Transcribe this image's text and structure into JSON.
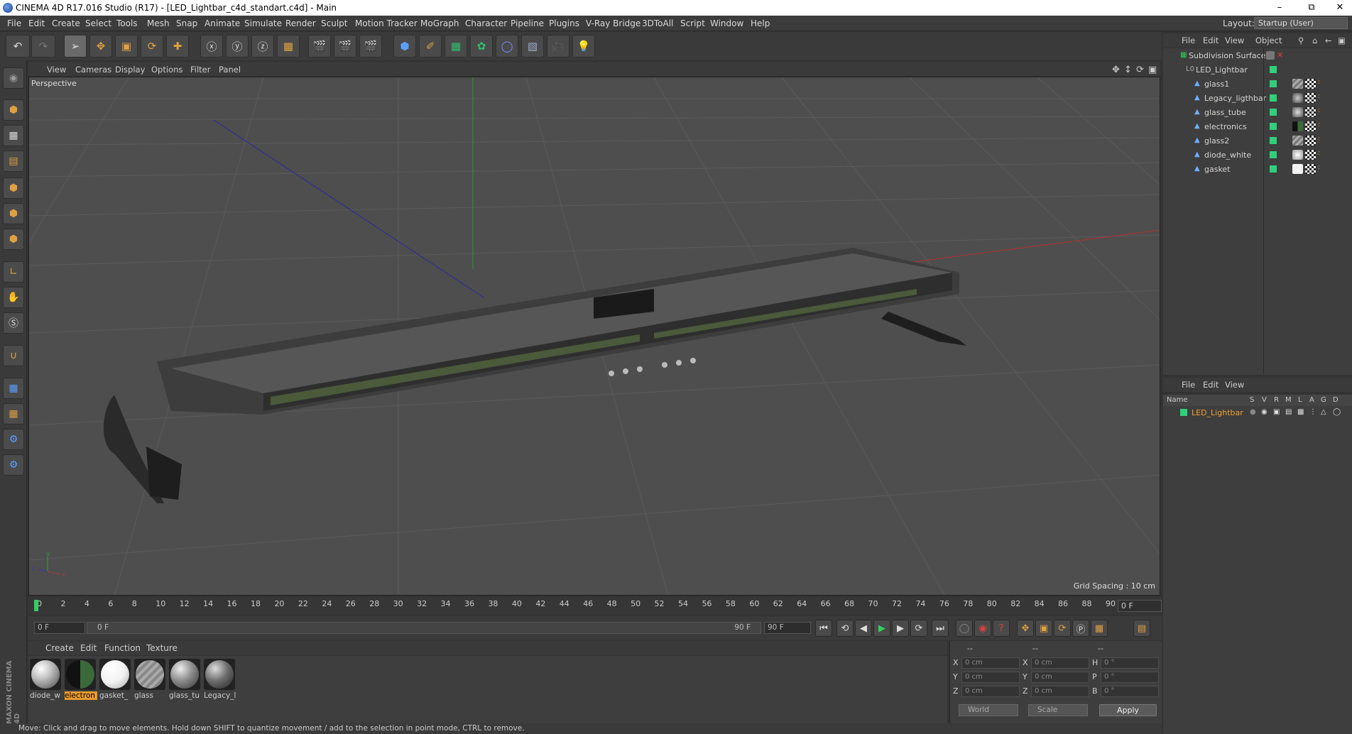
{
  "window": {
    "title": "CINEMA 4D R17.016 Studio (R17) - [LED_Lightbar_c4d_standart.c4d] - Main"
  },
  "menubar": {
    "items": [
      "File",
      "Edit",
      "Create",
      "Select",
      "Tools",
      "Mesh",
      "Snap",
      "Animate",
      "Simulate",
      "Render",
      "Sculpt",
      "Motion Tracker",
      "MoGraph",
      "Character",
      "Pipeline",
      "Plugins",
      "V-Ray Bridge",
      "3DToAll",
      "Script",
      "Window",
      "Help"
    ],
    "layout_label": "Layout:",
    "layout_value": "Startup (User)"
  },
  "viewport": {
    "menu": [
      "View",
      "Cameras",
      "Display",
      "Options",
      "Filter",
      "Panel"
    ],
    "label": "Perspective",
    "grid_spacing": "Grid Spacing : 10 cm"
  },
  "timeline": {
    "ticks": [
      "0",
      "2",
      "4",
      "6",
      "8",
      "10",
      "12",
      "14",
      "16",
      "18",
      "20",
      "22",
      "24",
      "26",
      "28",
      "30",
      "32",
      "34",
      "36",
      "38",
      "40",
      "42",
      "44",
      "46",
      "48",
      "50",
      "52",
      "54",
      "56",
      "58",
      "60",
      "62",
      "64",
      "66",
      "68",
      "70",
      "72",
      "74",
      "76",
      "78",
      "80",
      "82",
      "84",
      "86",
      "88",
      "90"
    ],
    "current_frame": "0 F",
    "start_field": "0 F",
    "range_start": "0 F",
    "range_end": "90 F",
    "end_field": "90 F"
  },
  "materials": {
    "menu": [
      "Create",
      "Edit",
      "Function",
      "Texture"
    ],
    "items": [
      {
        "name": "diode_w",
        "color": "#bdbdbd",
        "selected": false
      },
      {
        "name": "electron",
        "color": "#2b2b2b",
        "selected": true
      },
      {
        "name": "gasket_",
        "color": "#f2f2f2",
        "selected": false
      },
      {
        "name": "glass",
        "color": "#9a9a9a",
        "selected": false
      },
      {
        "name": "glass_tu",
        "color": "#8c8c8c",
        "selected": false
      },
      {
        "name": "Legacy_l",
        "color": "#6f6f6f",
        "selected": false
      }
    ]
  },
  "coords": {
    "header_left": "--",
    "header_mid": "--",
    "header_right": "--",
    "rows": [
      {
        "a": "X",
        "av": "0 cm",
        "b": "X",
        "bv": "0 cm",
        "c": "H",
        "cv": "0 °"
      },
      {
        "a": "Y",
        "av": "0 cm",
        "b": "Y",
        "bv": "0 cm",
        "c": "P",
        "cv": "0 °"
      },
      {
        "a": "Z",
        "av": "0 cm",
        "b": "Z",
        "bv": "0 cm",
        "c": "B",
        "cv": "0 °"
      }
    ],
    "mode": "World",
    "scale": "Scale",
    "apply": "Apply"
  },
  "object_manager": {
    "menu": [
      "File",
      "Edit",
      "View",
      "Object"
    ],
    "objects": [
      {
        "name": "Subdivision Surface",
        "level": 0,
        "icon": "subdivision-icon"
      },
      {
        "name": "LED_Lightbar",
        "level": 1,
        "icon": "null-icon"
      },
      {
        "name": "glass1",
        "level": 2,
        "icon": "polygon-icon"
      },
      {
        "name": "Legacy_ligthbar",
        "level": 2,
        "icon": "polygon-icon"
      },
      {
        "name": "glass_tube",
        "level": 2,
        "icon": "polygon-icon"
      },
      {
        "name": "electronics",
        "level": 2,
        "icon": "polygon-icon"
      },
      {
        "name": "glass2",
        "level": 2,
        "icon": "polygon-icon"
      },
      {
        "name": "diode_white",
        "level": 2,
        "icon": "polygon-icon"
      },
      {
        "name": "gasket",
        "level": 2,
        "icon": "polygon-icon"
      }
    ]
  },
  "attribute_manager": {
    "menu": [
      "File",
      "Edit",
      "View"
    ],
    "columns": [
      "Name",
      "S",
      "V",
      "R",
      "M",
      "L",
      "A",
      "G",
      "D"
    ],
    "row": "LED_Lightbar"
  },
  "status": "Move: Click and drag to move elements. Hold down SHIFT to quantize movement / add to the selection in point mode, CTRL to remove.",
  "brand": "MAXON CINEMA 4D",
  "colors": {
    "accent": "#e89a2c",
    "green_check": "#2fd07a",
    "viewport_bg": "#4e4e4e"
  }
}
